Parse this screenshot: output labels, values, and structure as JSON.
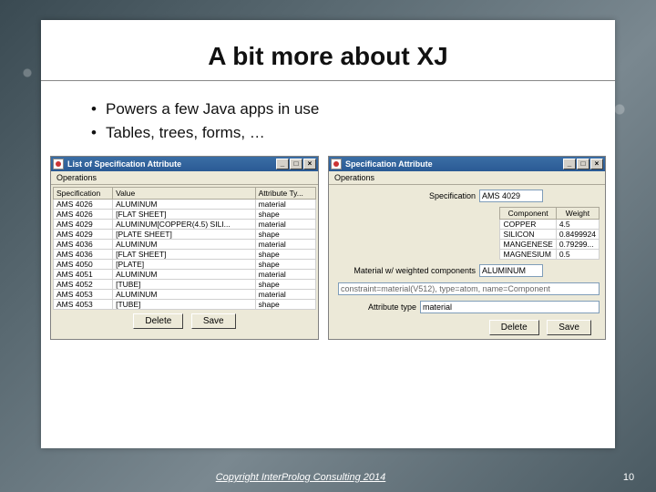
{
  "slide": {
    "title": "A bit more about XJ",
    "bullets": [
      "Powers a few Java apps in use",
      "Tables, trees, forms, …"
    ]
  },
  "win_left": {
    "title": "List of Specification Attribute",
    "menu": "Operations",
    "columns": [
      "Specification",
      "Value",
      "Attribute Ty..."
    ],
    "rows": [
      [
        "AMS 4026",
        "ALUMINUM",
        "material"
      ],
      [
        "AMS 4026",
        "[FLAT SHEET]",
        "shape"
      ],
      [
        "AMS 4029",
        "ALUMINUM[COPPER(4.5) SILI...",
        "material"
      ],
      [
        "AMS 4029",
        "[PLATE SHEET]",
        "shape"
      ],
      [
        "AMS 4036",
        "ALUMINUM",
        "material"
      ],
      [
        "AMS 4036",
        "[FLAT SHEET]",
        "shape"
      ],
      [
        "AMS 4050",
        "[PLATE]",
        "shape"
      ],
      [
        "AMS 4051",
        "ALUMINUM",
        "material"
      ],
      [
        "AMS 4052",
        "[TUBE]",
        "shape"
      ],
      [
        "AMS 4053",
        "ALUMINUM",
        "material"
      ],
      [
        "AMS 4053",
        "[TUBE]",
        "shape"
      ]
    ],
    "delete": "Delete",
    "save": "Save"
  },
  "win_right": {
    "title": "Specification Attribute",
    "menu": "Operations",
    "spec_label": "Specification",
    "spec_value": "AMS 4029",
    "comp_headers": [
      "Component",
      "Weight"
    ],
    "comp_rows": [
      [
        "COPPER",
        "4.5"
      ],
      [
        "SILICON",
        "0.8499924"
      ],
      [
        "MANGENESE",
        "0.79299..."
      ],
      [
        "MAGNESIUM",
        "0.5"
      ]
    ],
    "mat_label": "Material w/ weighted components",
    "mat_value": "ALUMINUM",
    "constraint": "constraint=material(V512), type=atom, name=Component",
    "attr_label": "Attribute type",
    "attr_value": "material",
    "delete": "Delete",
    "save": "Save"
  },
  "winbtns": {
    "min": "_",
    "max": "□",
    "close": "×"
  },
  "footer": {
    "copyright": "Copyright InterProlog Consulting 2014",
    "page": "10"
  }
}
